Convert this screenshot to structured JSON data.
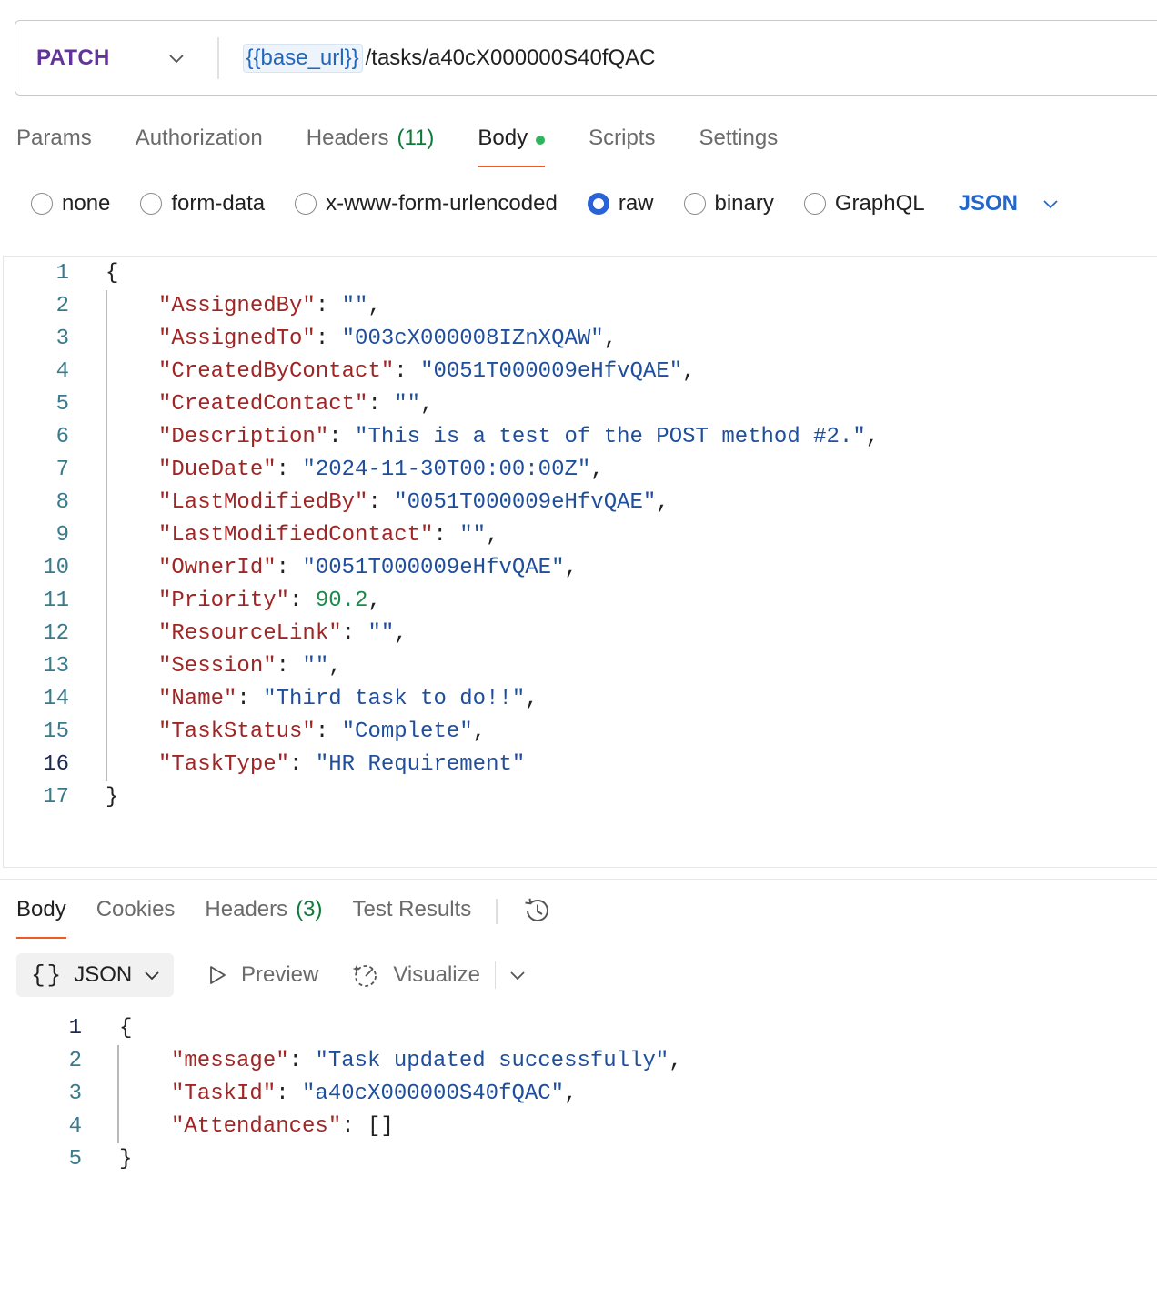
{
  "request": {
    "method": "PATCH",
    "url_variable": "{{base_url}}",
    "url_path": "/tasks/a40cX000000S40fQAC"
  },
  "request_tabs": [
    {
      "label": "Params",
      "count": ""
    },
    {
      "label": "Authorization",
      "count": ""
    },
    {
      "label": "Headers",
      "count": "(11)"
    },
    {
      "label": "Body",
      "count": ""
    },
    {
      "label": "Scripts",
      "count": ""
    },
    {
      "label": "Settings",
      "count": ""
    }
  ],
  "body_types": {
    "options": [
      "none",
      "form-data",
      "x-www-form-urlencoded",
      "raw",
      "binary",
      "GraphQL"
    ],
    "selected": "raw",
    "language": "JSON"
  },
  "request_body": {
    "line_numbers": [
      "1",
      "2",
      "3",
      "4",
      "5",
      "6",
      "7",
      "8",
      "9",
      "10",
      "11",
      "12",
      "13",
      "14",
      "15",
      "16",
      "17"
    ],
    "open_brace": "{",
    "close_brace": "}",
    "fields": [
      {
        "key": "\"AssignedBy\"",
        "value": "\"\"",
        "type": "str",
        "comma": ","
      },
      {
        "key": "\"AssignedTo\"",
        "value": "\"003cX000008IZnXQAW\"",
        "type": "str",
        "comma": ","
      },
      {
        "key": "\"CreatedByContact\"",
        "value": "\"0051T000009eHfvQAE\"",
        "type": "str",
        "comma": ","
      },
      {
        "key": "\"CreatedContact\"",
        "value": "\"\"",
        "type": "str",
        "comma": ","
      },
      {
        "key": "\"Description\"",
        "value": "\"This is a test of the POST method #2.\"",
        "type": "str",
        "comma": ","
      },
      {
        "key": "\"DueDate\"",
        "value": "\"2024-11-30T00:00:00Z\"",
        "type": "str",
        "comma": ","
      },
      {
        "key": "\"LastModifiedBy\"",
        "value": "\"0051T000009eHfvQAE\"",
        "type": "str",
        "comma": ","
      },
      {
        "key": "\"LastModifiedContact\"",
        "value": "\"\"",
        "type": "str",
        "comma": ","
      },
      {
        "key": "\"OwnerId\"",
        "value": "\"0051T000009eHfvQAE\"",
        "type": "str",
        "comma": ","
      },
      {
        "key": "\"Priority\"",
        "value": "90.2",
        "type": "num",
        "comma": ","
      },
      {
        "key": "\"ResourceLink\"",
        "value": "\"\"",
        "type": "str",
        "comma": ","
      },
      {
        "key": "\"Session\"",
        "value": "\"\"",
        "type": "str",
        "comma": ","
      },
      {
        "key": "\"Name\"",
        "value": "\"Third task to do!!\"",
        "type": "str",
        "comma": ","
      },
      {
        "key": "\"TaskStatus\"",
        "value": "\"Complete\"",
        "type": "str",
        "comma": ","
      },
      {
        "key": "\"TaskType\"",
        "value": "\"HR Requirement\"",
        "type": "str",
        "comma": ""
      }
    ],
    "current_line": "16"
  },
  "response_tabs": [
    {
      "label": "Body",
      "count": ""
    },
    {
      "label": "Cookies",
      "count": ""
    },
    {
      "label": "Headers",
      "count": "(3)"
    },
    {
      "label": "Test Results",
      "count": ""
    }
  ],
  "response_toolbar": {
    "format_braces": "{}",
    "format_label": "JSON",
    "preview_label": "Preview",
    "visualize_label": "Visualize"
  },
  "response_body": {
    "line_numbers": [
      "1",
      "2",
      "3",
      "4",
      "5"
    ],
    "open_brace": "{",
    "close_brace": "}",
    "fields": [
      {
        "key": "\"message\"",
        "value": "\"Task updated successfully\"",
        "type": "str",
        "comma": ","
      },
      {
        "key": "\"TaskId\"",
        "value": "\"a40cX000000S40fQAC\"",
        "type": "str",
        "comma": ","
      },
      {
        "key": "\"Attendances\"",
        "value": "[]",
        "type": "punc",
        "comma": ""
      }
    ],
    "current_line": "1"
  }
}
